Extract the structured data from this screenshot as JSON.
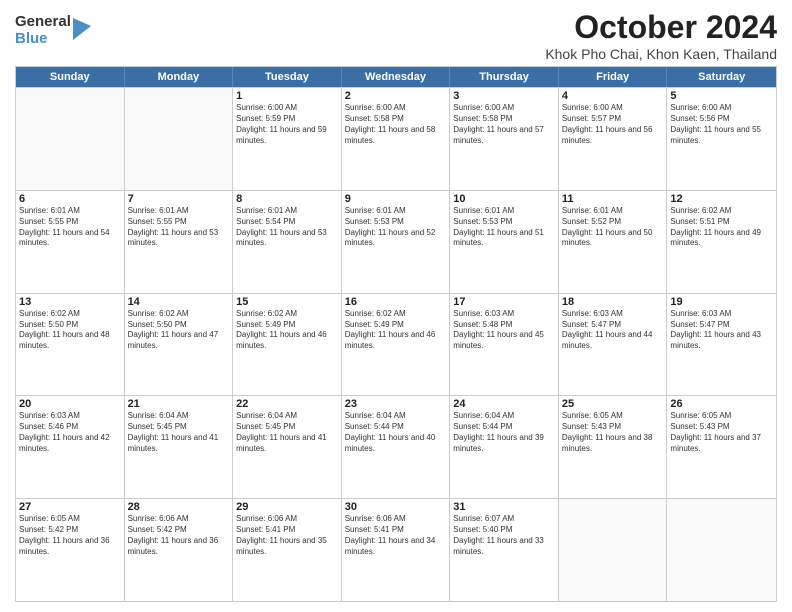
{
  "logo": {
    "general": "General",
    "blue": "Blue"
  },
  "title": "October 2024",
  "subtitle": "Khok Pho Chai, Khon Kaen, Thailand",
  "days": [
    "Sunday",
    "Monday",
    "Tuesday",
    "Wednesday",
    "Thursday",
    "Friday",
    "Saturday"
  ],
  "weeks": [
    [
      {
        "day": "",
        "text": ""
      },
      {
        "day": "",
        "text": ""
      },
      {
        "day": "1",
        "text": "Sunrise: 6:00 AM\nSunset: 5:59 PM\nDaylight: 11 hours and 59 minutes."
      },
      {
        "day": "2",
        "text": "Sunrise: 6:00 AM\nSunset: 5:58 PM\nDaylight: 11 hours and 58 minutes."
      },
      {
        "day": "3",
        "text": "Sunrise: 6:00 AM\nSunset: 5:58 PM\nDaylight: 11 hours and 57 minutes."
      },
      {
        "day": "4",
        "text": "Sunrise: 6:00 AM\nSunset: 5:57 PM\nDaylight: 11 hours and 56 minutes."
      },
      {
        "day": "5",
        "text": "Sunrise: 6:00 AM\nSunset: 5:56 PM\nDaylight: 11 hours and 55 minutes."
      }
    ],
    [
      {
        "day": "6",
        "text": "Sunrise: 6:01 AM\nSunset: 5:55 PM\nDaylight: 11 hours and 54 minutes."
      },
      {
        "day": "7",
        "text": "Sunrise: 6:01 AM\nSunset: 5:55 PM\nDaylight: 11 hours and 53 minutes."
      },
      {
        "day": "8",
        "text": "Sunrise: 6:01 AM\nSunset: 5:54 PM\nDaylight: 11 hours and 53 minutes."
      },
      {
        "day": "9",
        "text": "Sunrise: 6:01 AM\nSunset: 5:53 PM\nDaylight: 11 hours and 52 minutes."
      },
      {
        "day": "10",
        "text": "Sunrise: 6:01 AM\nSunset: 5:53 PM\nDaylight: 11 hours and 51 minutes."
      },
      {
        "day": "11",
        "text": "Sunrise: 6:01 AM\nSunset: 5:52 PM\nDaylight: 11 hours and 50 minutes."
      },
      {
        "day": "12",
        "text": "Sunrise: 6:02 AM\nSunset: 5:51 PM\nDaylight: 11 hours and 49 minutes."
      }
    ],
    [
      {
        "day": "13",
        "text": "Sunrise: 6:02 AM\nSunset: 5:50 PM\nDaylight: 11 hours and 48 minutes."
      },
      {
        "day": "14",
        "text": "Sunrise: 6:02 AM\nSunset: 5:50 PM\nDaylight: 11 hours and 47 minutes."
      },
      {
        "day": "15",
        "text": "Sunrise: 6:02 AM\nSunset: 5:49 PM\nDaylight: 11 hours and 46 minutes."
      },
      {
        "day": "16",
        "text": "Sunrise: 6:02 AM\nSunset: 5:49 PM\nDaylight: 11 hours and 46 minutes."
      },
      {
        "day": "17",
        "text": "Sunrise: 6:03 AM\nSunset: 5:48 PM\nDaylight: 11 hours and 45 minutes."
      },
      {
        "day": "18",
        "text": "Sunrise: 6:03 AM\nSunset: 5:47 PM\nDaylight: 11 hours and 44 minutes."
      },
      {
        "day": "19",
        "text": "Sunrise: 6:03 AM\nSunset: 5:47 PM\nDaylight: 11 hours and 43 minutes."
      }
    ],
    [
      {
        "day": "20",
        "text": "Sunrise: 6:03 AM\nSunset: 5:46 PM\nDaylight: 11 hours and 42 minutes."
      },
      {
        "day": "21",
        "text": "Sunrise: 6:04 AM\nSunset: 5:45 PM\nDaylight: 11 hours and 41 minutes."
      },
      {
        "day": "22",
        "text": "Sunrise: 6:04 AM\nSunset: 5:45 PM\nDaylight: 11 hours and 41 minutes."
      },
      {
        "day": "23",
        "text": "Sunrise: 6:04 AM\nSunset: 5:44 PM\nDaylight: 11 hours and 40 minutes."
      },
      {
        "day": "24",
        "text": "Sunrise: 6:04 AM\nSunset: 5:44 PM\nDaylight: 11 hours and 39 minutes."
      },
      {
        "day": "25",
        "text": "Sunrise: 6:05 AM\nSunset: 5:43 PM\nDaylight: 11 hours and 38 minutes."
      },
      {
        "day": "26",
        "text": "Sunrise: 6:05 AM\nSunset: 5:43 PM\nDaylight: 11 hours and 37 minutes."
      }
    ],
    [
      {
        "day": "27",
        "text": "Sunrise: 6:05 AM\nSunset: 5:42 PM\nDaylight: 11 hours and 36 minutes."
      },
      {
        "day": "28",
        "text": "Sunrise: 6:06 AM\nSunset: 5:42 PM\nDaylight: 11 hours and 36 minutes."
      },
      {
        "day": "29",
        "text": "Sunrise: 6:06 AM\nSunset: 5:41 PM\nDaylight: 11 hours and 35 minutes."
      },
      {
        "day": "30",
        "text": "Sunrise: 6:06 AM\nSunset: 5:41 PM\nDaylight: 11 hours and 34 minutes."
      },
      {
        "day": "31",
        "text": "Sunrise: 6:07 AM\nSunset: 5:40 PM\nDaylight: 11 hours and 33 minutes."
      },
      {
        "day": "",
        "text": ""
      },
      {
        "day": "",
        "text": ""
      }
    ]
  ]
}
